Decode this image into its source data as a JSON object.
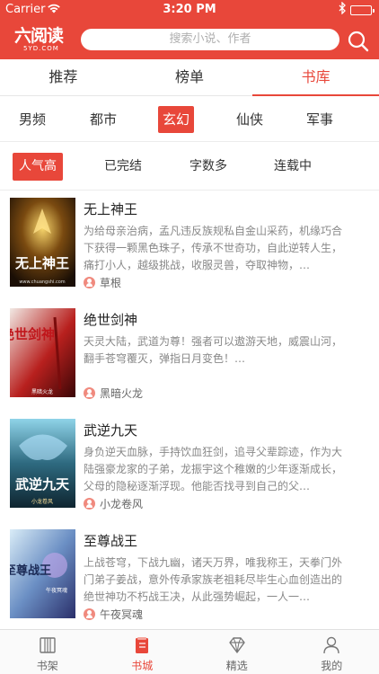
{
  "status_bar": {
    "carrier": "Carrier",
    "time": "3:20 PM"
  },
  "header": {
    "logo_text": "六阅读",
    "logo_sub": "5YD.COM",
    "search_placeholder": "搜索小说、作者",
    "accent_color": "#e8473a"
  },
  "tabs": [
    {
      "label": "推荐",
      "active": false
    },
    {
      "label": "榜单",
      "active": false
    },
    {
      "label": "书库",
      "active": true
    }
  ],
  "genres": [
    {
      "label": "男频",
      "active": false
    },
    {
      "label": "都市",
      "active": false
    },
    {
      "label": "玄幻",
      "active": true
    },
    {
      "label": "仙侠",
      "active": false
    },
    {
      "label": "军事",
      "active": false
    }
  ],
  "sorts": [
    {
      "label": "人气高",
      "active": true
    },
    {
      "label": "已完结",
      "active": false
    },
    {
      "label": "字数多",
      "active": false
    },
    {
      "label": "连载中",
      "active": false
    }
  ],
  "books": [
    {
      "title": "无上神王",
      "desc": "为给母亲治病，孟凡违反族规私自金山采药，机缘巧合下获得一颗黑色珠子，传承不世奇功，自此逆转人生，痛打小人，越级挑战，收服灵兽，夺取神物，…",
      "author": "草根",
      "cover_text": "无上神王",
      "cover_sub": "www.chuangshi.com"
    },
    {
      "title": "绝世剑神",
      "desc": "天灵大陆，武道为尊！强者可以遨游天地，威震山河，翻手苍穹覆灭，弹指日月变色！…",
      "author": "黑暗火龙",
      "cover_text": "绝世剑神",
      "cover_sub": "黑暗火龙"
    },
    {
      "title": "武逆九天",
      "desc": "身负逆天血脉，手持饮血狂剑，追寻父辈踪迹，作为大陆强豪龙家的子弟，龙振宇这个稚嫩的少年逐渐成长，父母的隐秘逐渐浮现。他能否找寻到自己的父…",
      "author": "小龙卷风",
      "cover_text": "武逆九天",
      "cover_sub": "小龙卷风"
    },
    {
      "title": "至尊战王",
      "desc": "上战苍穹，下战九幽，诸天万界，唯我称王，天拳门外门弟子姜战，意外传承家族老祖耗尽毕生心血创造出的绝世神功不朽战王决，从此强势崛起，一人一…",
      "author": "午夜冥魂",
      "cover_text": "至尊战王",
      "cover_sub": "午夜冥魂"
    }
  ],
  "bottom_tabs": [
    {
      "label": "书架",
      "icon": "bookshelf-icon",
      "active": false
    },
    {
      "label": "书城",
      "icon": "bookstore-icon",
      "active": true
    },
    {
      "label": "精选",
      "icon": "diamond-icon",
      "active": false
    },
    {
      "label": "我的",
      "icon": "profile-icon",
      "active": false
    }
  ]
}
